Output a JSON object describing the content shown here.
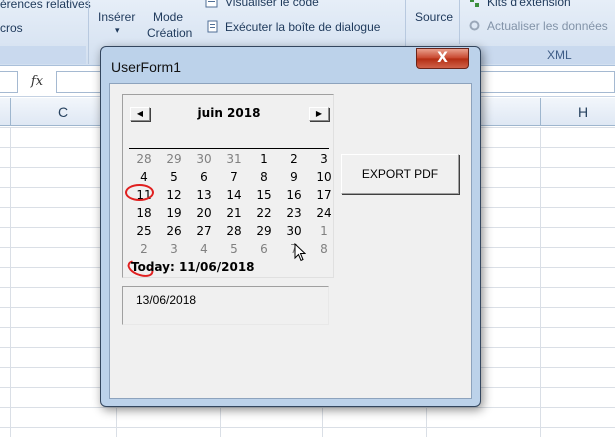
{
  "ribbon": {
    "partial_items": [
      {
        "id": "references-relatives",
        "label": "érences relatives"
      },
      {
        "id": "macros",
        "label": "cros"
      },
      {
        "id": "inserer",
        "label": "Insérer"
      },
      {
        "id": "mode",
        "label": "Mode"
      },
      {
        "id": "creation",
        "label": "Création"
      },
      {
        "id": "visualiser-code",
        "label": "Visualiser le code"
      },
      {
        "id": "executer-boite",
        "label": "Exécuter la boîte de dialogue"
      },
      {
        "id": "source",
        "label": "Source"
      },
      {
        "id": "kits-extension",
        "label": "Kits d'extension"
      },
      {
        "id": "actualiser-donnees",
        "label": "Actualiser les données"
      }
    ],
    "xml_group_label": "XML",
    "dropdown_glyph": "▾"
  },
  "formula_bar": {
    "fx_label": "fx"
  },
  "sheet": {
    "column_labels": {
      "c": "C",
      "h": "H"
    }
  },
  "userform": {
    "title": "UserForm1",
    "close_glyph": "X",
    "calendar": {
      "month_label": "juin 2018",
      "prev_glyph": "◀",
      "next_glyph": "▶",
      "weeks": [
        [
          {
            "d": "28",
            "o": true
          },
          {
            "d": "29",
            "o": true
          },
          {
            "d": "30",
            "o": true
          },
          {
            "d": "31",
            "o": true
          },
          {
            "d": "1"
          },
          {
            "d": "2"
          },
          {
            "d": "3"
          }
        ],
        [
          {
            "d": "4"
          },
          {
            "d": "5"
          },
          {
            "d": "6"
          },
          {
            "d": "7"
          },
          {
            "d": "8"
          },
          {
            "d": "9"
          },
          {
            "d": "10"
          }
        ],
        [
          {
            "d": "11"
          },
          {
            "d": "12"
          },
          {
            "d": "13"
          },
          {
            "d": "14"
          },
          {
            "d": "15"
          },
          {
            "d": "16"
          },
          {
            "d": "17"
          }
        ],
        [
          {
            "d": "18"
          },
          {
            "d": "19"
          },
          {
            "d": "20"
          },
          {
            "d": "21"
          },
          {
            "d": "22"
          },
          {
            "d": "23"
          },
          {
            "d": "24"
          }
        ],
        [
          {
            "d": "25"
          },
          {
            "d": "26"
          },
          {
            "d": "27"
          },
          {
            "d": "28"
          },
          {
            "d": "29"
          },
          {
            "d": "30"
          },
          {
            "d": "1",
            "o": true
          }
        ],
        [
          {
            "d": "2",
            "o": true
          },
          {
            "d": "3",
            "o": true
          },
          {
            "d": "4",
            "o": true
          },
          {
            "d": "5",
            "o": true
          },
          {
            "d": "6",
            "o": true
          },
          {
            "d": "7",
            "o": true
          },
          {
            "d": "8",
            "o": true
          }
        ]
      ],
      "today_label": "Today: 11/06/2018"
    },
    "selected_date": "13/06/2018",
    "export_button_label": "EXPORT PDF"
  },
  "colors": {
    "today_circle": "#e02020",
    "other_month_day": "#808080",
    "close_button": "#c6432a"
  }
}
